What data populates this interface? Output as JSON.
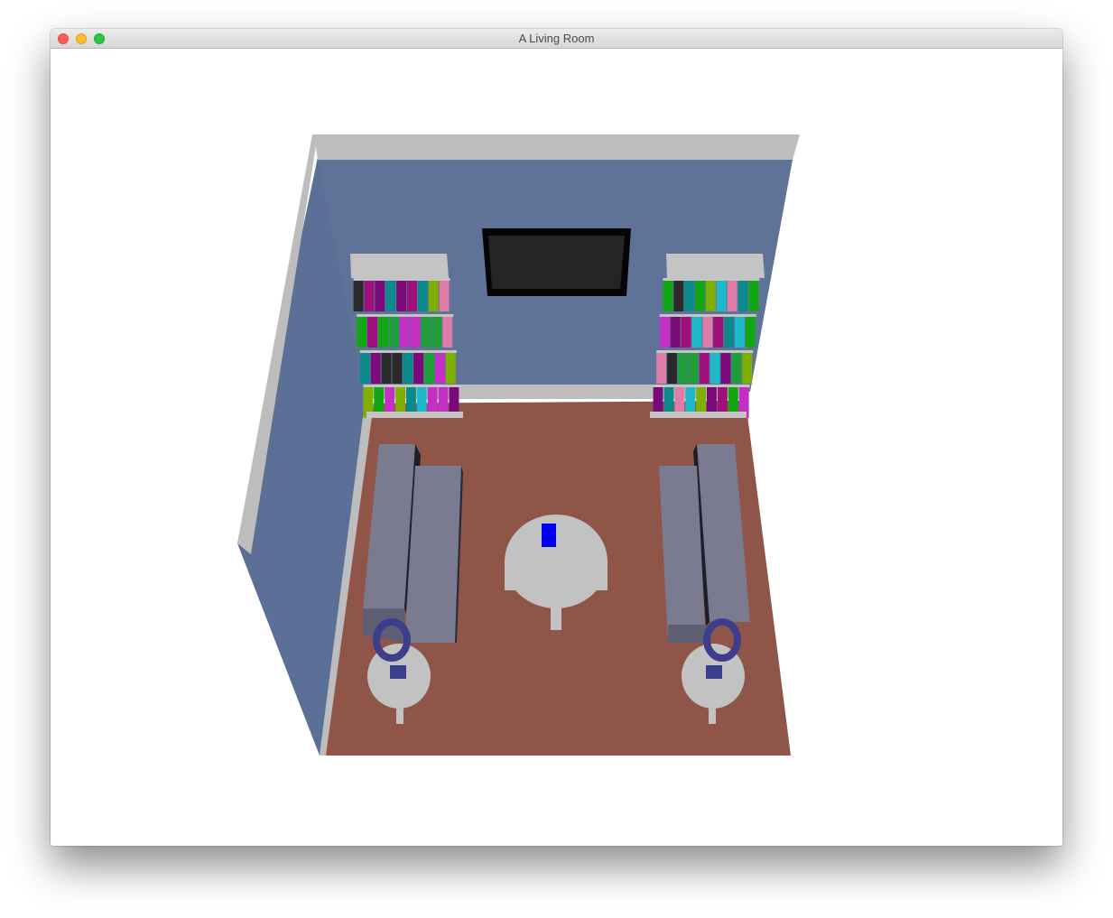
{
  "window": {
    "title": "A Living Room"
  },
  "scene": {
    "icon": "3d-scene",
    "colors": {
      "wall": "#5f7399",
      "wall_side": "#5c6f96",
      "wall_trim": "#bdbdbd",
      "floor": "#8f5548",
      "tv_frame": "#050505",
      "tv_screen": "#252525",
      "bookshelf": "#c4c4c4",
      "sofa": "#7a7a90",
      "table": "#c2c2c2",
      "chair_back": "#3d3d8e",
      "phone": "#0000ee"
    },
    "book_colors": [
      "#1fb8c8",
      "#13a613",
      "#7a0a7a",
      "#e07ca8",
      "#7fb000",
      "#c430c4",
      "#1f9f3a",
      "#2a2a2a",
      "#a0107a",
      "#0a8a8a"
    ]
  }
}
